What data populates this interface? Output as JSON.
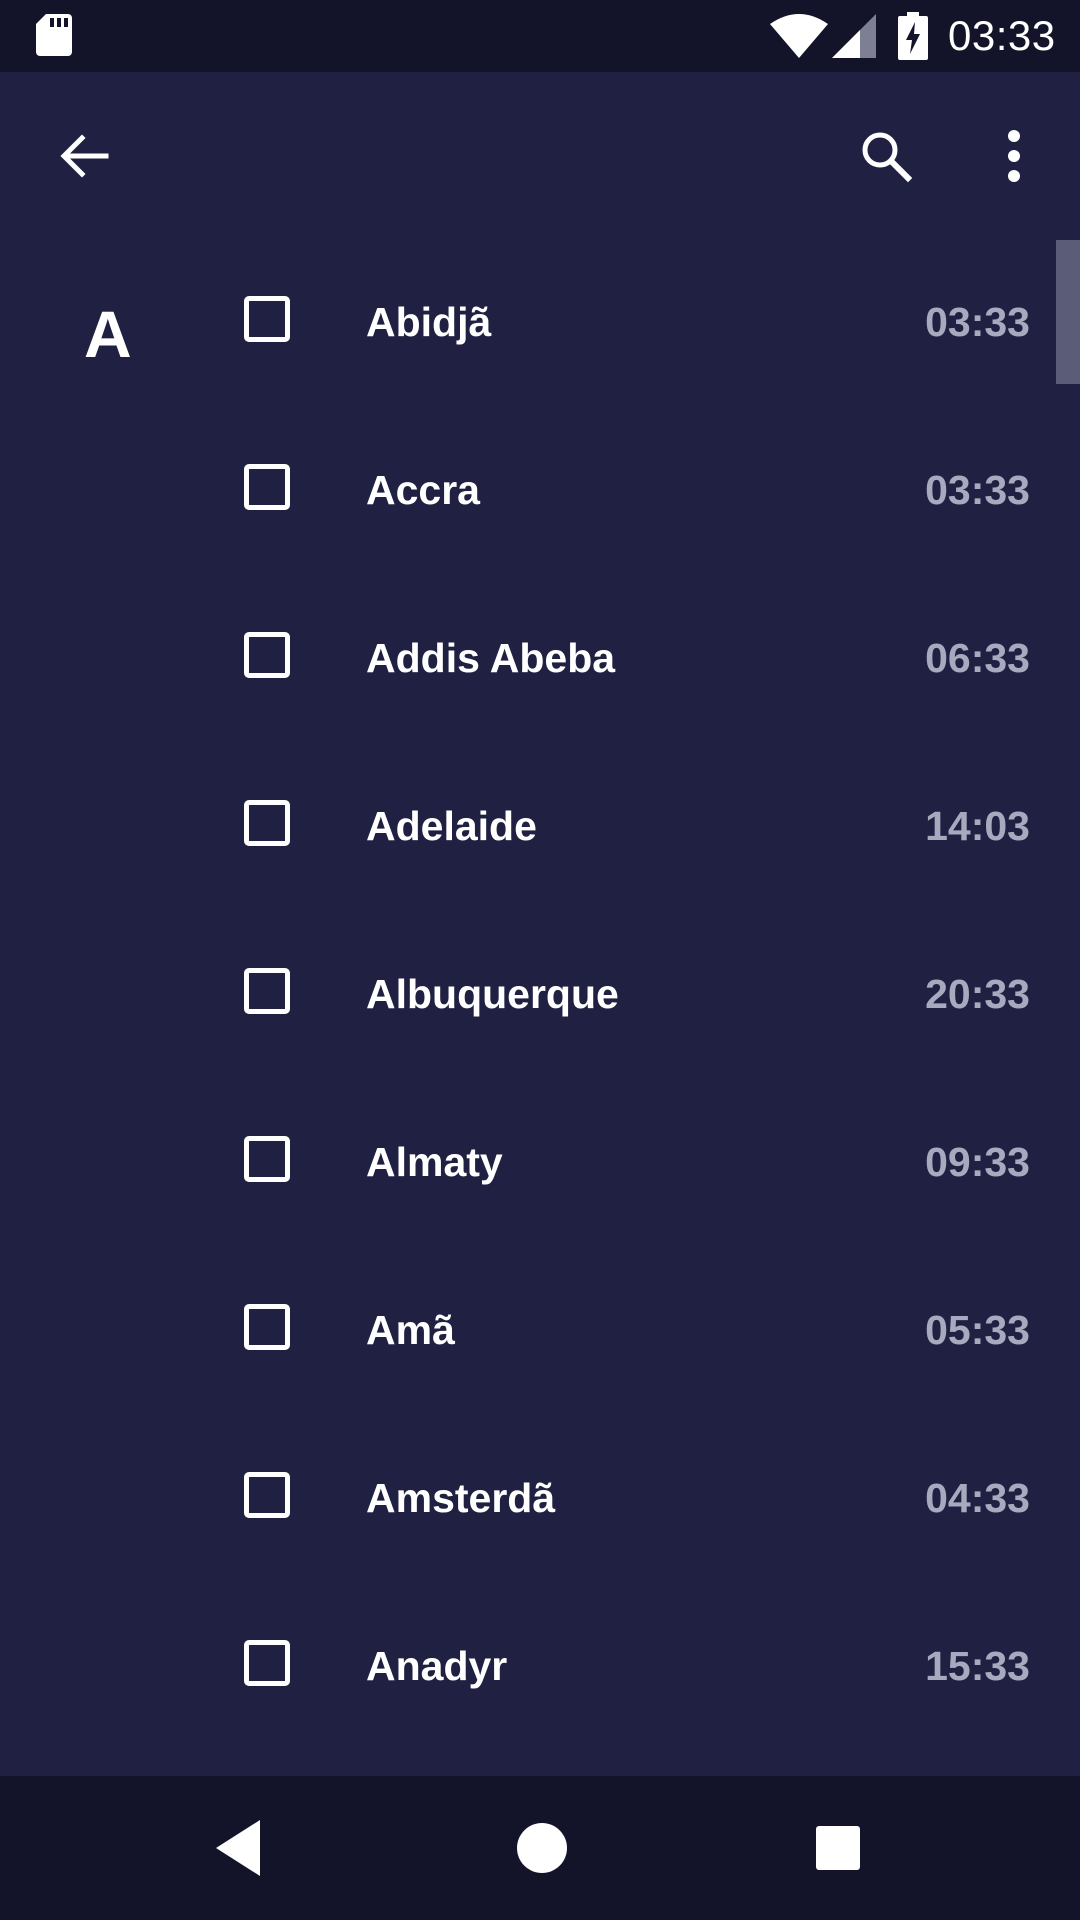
{
  "status_bar": {
    "time": "03:33",
    "icons": [
      "sd-card-icon",
      "wifi-icon",
      "signal-icon",
      "battery-charging-icon"
    ]
  },
  "app_bar": {
    "back_icon": "arrow-back-icon",
    "search_icon": "search-icon",
    "more_icon": "more-vert-icon"
  },
  "list": {
    "section_letter": "A",
    "items": [
      {
        "name": "Abidjã",
        "time": "03:33",
        "checked": false
      },
      {
        "name": "Accra",
        "time": "03:33",
        "checked": false
      },
      {
        "name": "Addis Abeba",
        "time": "06:33",
        "checked": false
      },
      {
        "name": "Adelaide",
        "time": "14:03",
        "checked": false
      },
      {
        "name": "Albuquerque",
        "time": "20:33",
        "checked": false
      },
      {
        "name": "Almaty",
        "time": "09:33",
        "checked": false
      },
      {
        "name": "Amã",
        "time": "05:33",
        "checked": false
      },
      {
        "name": "Amsterdã",
        "time": "04:33",
        "checked": false
      },
      {
        "name": "Anadyr",
        "time": "15:33",
        "checked": false
      }
    ]
  },
  "nav_bar": {
    "icons": [
      "nav-back-icon",
      "nav-home-icon",
      "nav-recents-icon"
    ]
  },
  "colors": {
    "background": "#202142",
    "status_bar": "#13142a",
    "nav_bar": "#13142a",
    "primary_text": "#ffffff",
    "secondary_text": "#a7a9be",
    "scroll_thumb": "#5a5c78"
  }
}
